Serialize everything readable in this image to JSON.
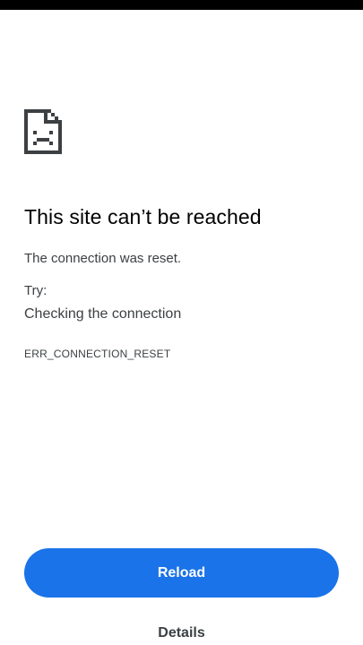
{
  "icon": "sad-page-icon",
  "error": {
    "title": "This site can’t be reached",
    "description": "The connection was reset.",
    "try_label": "Try:",
    "suggestion": "Checking the connection",
    "code": "ERR_CONNECTION_RESET"
  },
  "actions": {
    "reload_label": "Reload",
    "details_label": "Details"
  },
  "colors": {
    "accent": "#1a73e8",
    "text": "#202124",
    "secondary_text": "#3c4043",
    "background": "#ffffff"
  }
}
